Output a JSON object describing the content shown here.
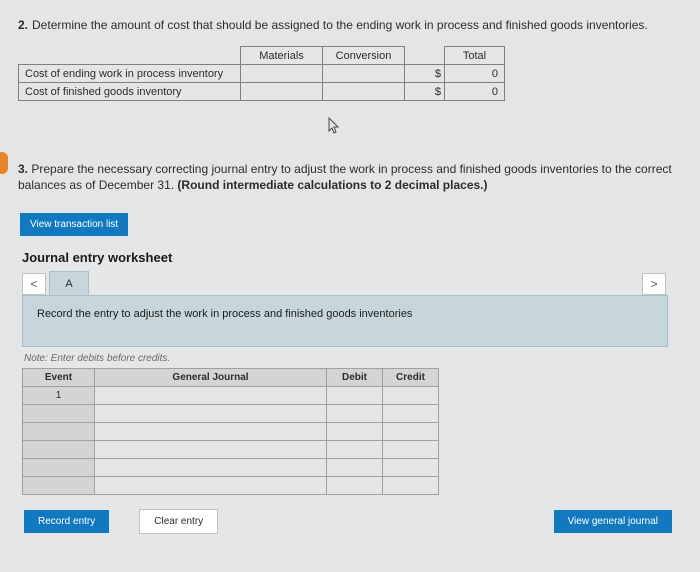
{
  "q2": {
    "num": "2.",
    "text": "Determine the amount of cost that should be assigned to the ending work in process and finished goods inventories."
  },
  "table1": {
    "headers": {
      "materials": "Materials",
      "conversion": "Conversion",
      "total": "Total"
    },
    "rows": [
      {
        "label": "Cost of ending work in process inventory",
        "dollar": "$",
        "total": "0"
      },
      {
        "label": "Cost of finished goods inventory",
        "dollar": "$",
        "total": "0"
      }
    ]
  },
  "q3": {
    "num": "3.",
    "text": "Prepare the necessary correcting journal entry to adjust the work in process and finished goods inventories to the correct balances as of December 31. ",
    "bold": "(Round intermediate calculations to 2 decimal places.)"
  },
  "viewList": "View transaction list",
  "ws": {
    "title": "Journal entry worksheet",
    "tabA": "A",
    "banner": "Record the entry to adjust the work in process and finished goods inventories",
    "note": "Note: Enter debits before credits.",
    "gj": {
      "headers": {
        "event": "Event",
        "gj": "General Journal",
        "debit": "Debit",
        "credit": "Credit"
      },
      "rowNum": "1"
    },
    "buttons": {
      "record": "Record entry",
      "clear": "Clear entry",
      "viewGJ": "View general journal"
    }
  },
  "nav": {
    "left": "<",
    "right": ">"
  }
}
